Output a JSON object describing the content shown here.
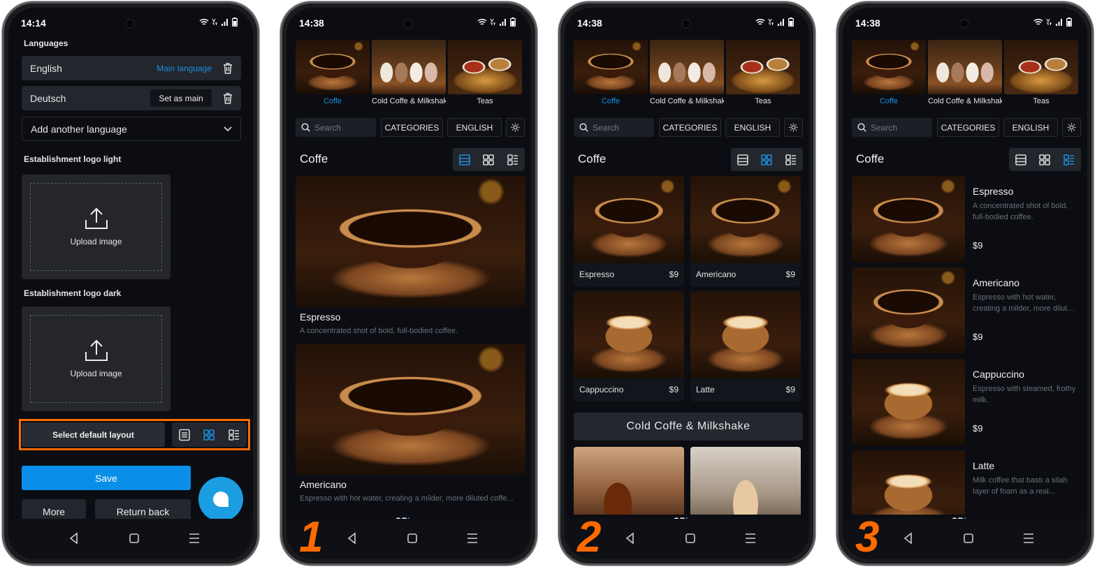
{
  "colors": {
    "accent": "#1a8fe0",
    "highlight": "#ff6a00",
    "background": "#0b0d12"
  },
  "phones": [
    {
      "time": "14:14"
    },
    {
      "time": "14:38",
      "step": "1"
    },
    {
      "time": "14:38",
      "step": "2"
    },
    {
      "time": "14:38",
      "step": "3"
    }
  ],
  "settings": {
    "languages_label": "Languages",
    "languages": [
      {
        "name": "English",
        "status": "Main language"
      },
      {
        "name": "Deutsch",
        "action": "Set as main"
      }
    ],
    "add_language": "Add another language",
    "logo_light_label": "Establishment logo light",
    "logo_dark_label": "Establishment logo dark",
    "upload_label": "Upload image",
    "select_layout": "Select default layout",
    "selected_layout": "grid",
    "save": "Save",
    "more": "More",
    "return_back": "Return back"
  },
  "menu": {
    "categories": [
      {
        "label": "Coffe",
        "active": true
      },
      {
        "label": "Cold Coffe & Milkshake"
      },
      {
        "label": "Teas"
      }
    ],
    "search_placeholder": "Search",
    "categories_button": "CATEGORIES",
    "language_button": "ENGLISH",
    "section_title": "Coffe",
    "second_section": "Cold Coffe & Milkshake",
    "items": [
      {
        "name": "Espresso",
        "desc": "A concentrated shot of bold, full-bodied coffee.",
        "price": "$9"
      },
      {
        "name": "Americano",
        "desc": "Espresso with hot water, creating a milder, more diluted coffe...",
        "price": "$9"
      },
      {
        "name": "Cappuccino",
        "desc": "Espresso with steamed, frothy milk.",
        "price": "$9"
      },
      {
        "name": "Latte",
        "desc": "Milk coffee that bastı a silah layer of foam as a real...",
        "price": "$9"
      }
    ],
    "brand": {
      "part1": "QR",
      "part2": "box"
    },
    "layouts": [
      "rows",
      "grid",
      "list"
    ]
  }
}
